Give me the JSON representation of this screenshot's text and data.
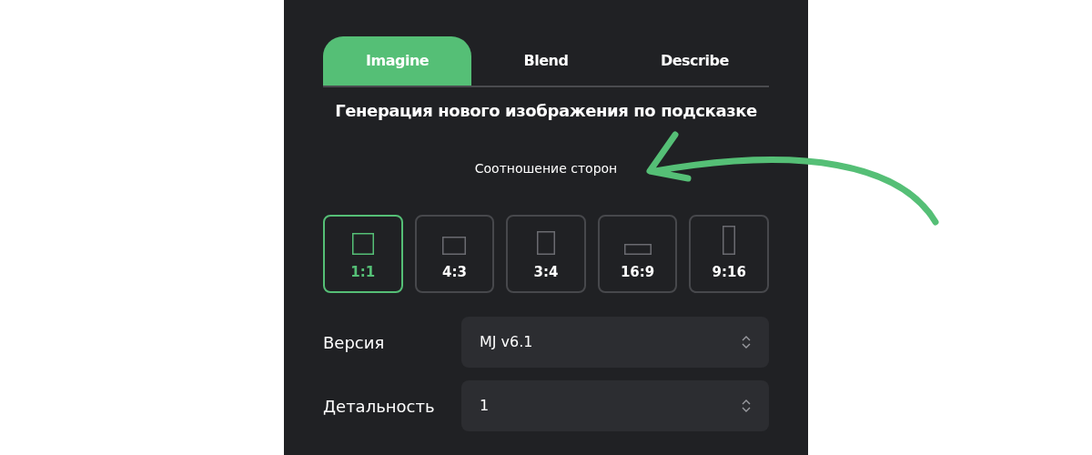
{
  "tabs": [
    {
      "label": "Imagine",
      "selected": true
    },
    {
      "label": "Blend",
      "selected": false
    },
    {
      "label": "Describe",
      "selected": false
    }
  ],
  "heading": "Генерация нового изображения по подсказке",
  "aspect_ratio": {
    "label": "Соотношение сторон",
    "options": [
      {
        "label": "1:1",
        "kind": "square",
        "selected": true
      },
      {
        "label": "4:3",
        "kind": "landscape",
        "selected": false
      },
      {
        "label": "3:4",
        "kind": "portrait",
        "selected": false
      },
      {
        "label": "16:9",
        "kind": "wide",
        "selected": false
      },
      {
        "label": "9:16",
        "kind": "tall",
        "selected": false
      }
    ]
  },
  "fields": [
    {
      "label": "Версия",
      "value": "MJ v6.1"
    },
    {
      "label": "Детальность",
      "value": "1"
    }
  ]
}
